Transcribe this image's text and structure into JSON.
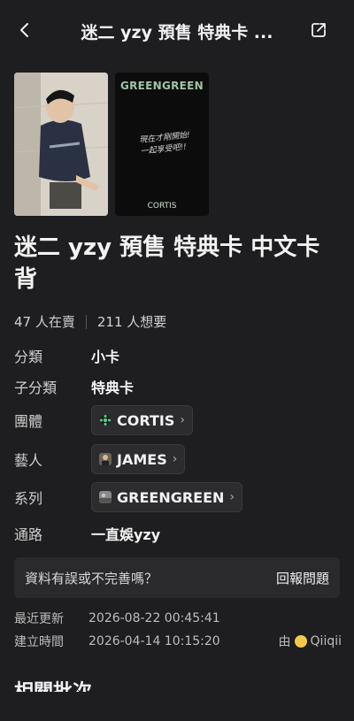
{
  "header": {
    "title": "迷二 yzy 預售 特典卡 ...",
    "back_icon": "chevron-left-icon",
    "share_icon": "share-icon"
  },
  "card_back": {
    "brand": "GREENGREEN",
    "handwriting_line1": "現在才剛開始!",
    "handwriting_line2": "一起享受吧!!",
    "logo": "CORTIS"
  },
  "main": {
    "title": "迷二 yzy 預售 特典卡 中文卡背",
    "stats": {
      "selling": "47 人在賣",
      "wanting": "211 人想要"
    }
  },
  "details": [
    {
      "label": "分類",
      "value": "小卡"
    },
    {
      "label": "子分類",
      "value": "特典卡"
    },
    {
      "label": "團體",
      "value": "CORTIS"
    },
    {
      "label": "藝人",
      "value": "JAMES"
    },
    {
      "label": "系列",
      "value": "GREENGREEN"
    },
    {
      "label": "通路",
      "value": "一直娛yzy"
    }
  ],
  "report": {
    "question": "資料有誤或不完善嗎？",
    "button": "回報問題"
  },
  "meta": {
    "updated_label": "最近更新",
    "updated_value": "2026-08-22 00:45:41",
    "created_label": "建立時間",
    "created_value": "2026-04-14 10:15:20",
    "by_label": "由",
    "creator": "Qiiqii"
  },
  "bottom_heading": "相關批次",
  "colors": {
    "background": "#1e1e20",
    "chip_bg": "#2c2c2f",
    "cortis_icon": "#5fd38a"
  }
}
